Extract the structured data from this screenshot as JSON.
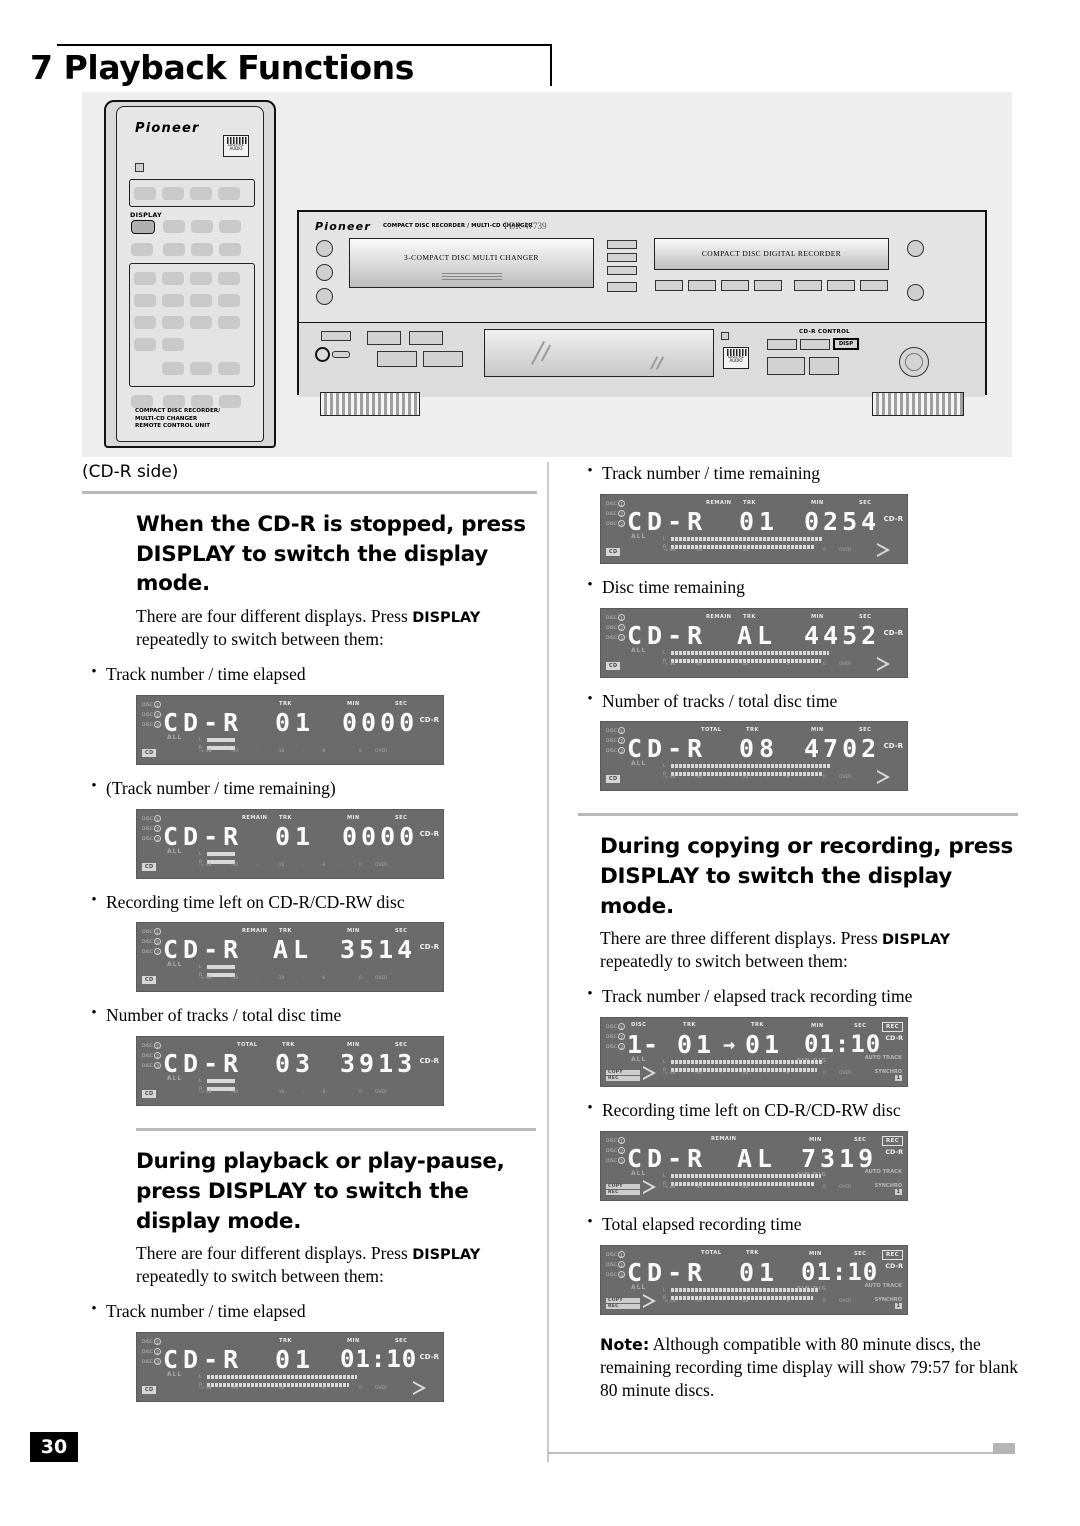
{
  "page": {
    "title": "7 Playback Functions",
    "number": "30"
  },
  "illustration": {
    "remote": {
      "brand": "Pioneer",
      "display_button_label": "DISPLAY",
      "footer_line1": "COMPACT DISC RECORDER/",
      "footer_line2": "MULTI-CD CHANGER",
      "footer_line3": "REMOTE CONTROL UNIT",
      "cd_logo": "COMPACT disc DIGITAL AUDIO"
    },
    "deck": {
      "brand": "Pioneer",
      "model_desc": "COMPACT DISC RECORDER / MULTI-CD CHANGER",
      "model_no": "PDR-W739",
      "changer_tray_label": "3-COMPACT DISC MULTI CHANGER",
      "recorder_tray_label": "COMPACT DISC DIGITAL RECORDER",
      "cdr_control_label": "CD-R CONTROL",
      "disp_button_label": "DISP"
    }
  },
  "left_column": {
    "cdr_side": "(CD-R side)",
    "section1": {
      "heading": "When the CD-R is stopped, press DISPLAY to switch the display mode.",
      "body_pre": "There are four different displays. Press ",
      "body_bold": "DISPLAY",
      "body_post": " repeatedly to switch between them:",
      "items": [
        {
          "label": "Track number / time elapsed"
        },
        {
          "label": "(Track number / time remaining)"
        },
        {
          "label": "Recording time left on CD-R/CD-RW disc"
        },
        {
          "label": "Number of tracks / total disc time"
        }
      ]
    },
    "section2": {
      "heading": "During playback or play-pause, press DISPLAY to switch the display mode.",
      "body_pre": "There are four different displays. Press ",
      "body_bold": "DISPLAY",
      "body_post": " repeatedly to switch between them:",
      "items": [
        {
          "label": "Track number / time elapsed"
        }
      ]
    }
  },
  "right_column": {
    "items_top": [
      {
        "label": "Track number / time remaining"
      },
      {
        "label": "Disc time remaining"
      },
      {
        "label": "Number of tracks / total disc time"
      }
    ],
    "section3": {
      "heading": "During copying or recording, press DISPLAY to switch the display mode.",
      "body_pre": "There are three different displays. Press ",
      "body_bold": "DISPLAY",
      "body_post": " repeatedly to switch between them:",
      "items": [
        {
          "label": "Track number / elapsed track recording time"
        },
        {
          "label": "Recording time left on CD-R/CD-RW disc"
        },
        {
          "label": "Total elapsed recording time"
        }
      ]
    },
    "note": {
      "bold": "Note:",
      "text": " Although compatible with 80 minute discs, the remaining recording time display will show 79:57 for blank 80 minute discs."
    }
  },
  "lcd_common": {
    "disc_labels": [
      "DISC",
      "DISC",
      "DISC"
    ],
    "disc_numbers": [
      "1",
      "2",
      "3"
    ],
    "all_tag": "ALL",
    "cdr_tag": "CD-R",
    "over_tag": "OVER",
    "meter_left": "L",
    "meter_right": "R",
    "scale": [
      "-∞",
      "dB",
      "-40",
      "-",
      "-18",
      "-",
      "-6",
      "-",
      "0"
    ],
    "fin_dig": "FIN DIG",
    "auto_track": "AUTO TRACK",
    "synchro": "SYNCHRO",
    "synchro_badge": "1",
    "rec_badge": "REC",
    "copy_label": "COPY",
    "rec_label": "REC"
  },
  "displays": {
    "l1": {
      "mode": "CD-R",
      "trk": "01",
      "time": "0000",
      "tags": {
        "trk": "TRK",
        "min": "MIN",
        "sec": "SEC"
      },
      "mode_box": "CD",
      "playing": false,
      "remain": false,
      "total": false
    },
    "l2": {
      "mode": "CD-R",
      "trk": "01",
      "time": "0000",
      "tags": {
        "remain": "REMAIN",
        "trk": "TRK",
        "min": "MIN",
        "sec": "SEC"
      },
      "mode_box": "CD",
      "playing": false,
      "remain": true,
      "total": false
    },
    "l3": {
      "mode": "CD-R",
      "trk": "AL",
      "time": "3514",
      "tags": {
        "remain": "REMAIN",
        "trk": "TRK",
        "min": "MIN",
        "sec": "SEC"
      },
      "mode_box": "CD",
      "playing": false,
      "remain": true,
      "total": false
    },
    "l4": {
      "mode": "CD-R",
      "trk": "03",
      "time": "3913",
      "tags": {
        "total": "TOTAL",
        "trk": "TRK",
        "min": "MIN",
        "sec": "SEC"
      },
      "mode_box": "CD",
      "playing": false,
      "remain": false,
      "total": true
    },
    "l5": {
      "mode": "CD-R",
      "trk": "01",
      "time": "01:10",
      "tags": {
        "trk": "TRK",
        "min": "MIN",
        "sec": "SEC"
      },
      "mode_box": "CD",
      "playing": true,
      "remain": false,
      "total": false
    },
    "r1": {
      "mode": "CD-R",
      "trk": "01",
      "time": "0254",
      "tags": {
        "remain": "REMAIN",
        "trk": "TRK",
        "min": "MIN",
        "sec": "SEC"
      },
      "mode_box": "CD",
      "playing": true,
      "remain": true,
      "total": false
    },
    "r2": {
      "mode": "CD-R",
      "trk": "AL",
      "time": "4452",
      "tags": {
        "remain": "REMAIN",
        "trk": "TRK",
        "min": "MIN",
        "sec": "SEC"
      },
      "mode_box": "CD",
      "playing": true,
      "remain": true,
      "total": false
    },
    "r3": {
      "mode": "CD-R",
      "trk": "08",
      "time": "4702",
      "tags": {
        "total": "TOTAL",
        "trk": "TRK",
        "min": "MIN",
        "sec": "SEC"
      },
      "mode_box": "CD",
      "playing": true,
      "remain": false,
      "total": true
    },
    "r4": {
      "mode": "1-",
      "trk": "01",
      "trk2": "01",
      "time": "01:10",
      "tags": {
        "disc": "DISC",
        "trk": "TRK",
        "trk2": "TRK",
        "min": "MIN",
        "sec": "SEC"
      },
      "recording": true,
      "playing": true
    },
    "r5": {
      "mode": "CD-R",
      "trk": "AL",
      "time": "7319",
      "tags": {
        "remain": "REMAIN",
        "min": "MIN",
        "sec": "SEC"
      },
      "recording": true,
      "playing": true
    },
    "r6": {
      "mode": "CD-R",
      "trk": "01",
      "time": "01:10",
      "tags": {
        "total": "TOTAL",
        "trk": "TRK",
        "min": "MIN",
        "sec": "SEC"
      },
      "recording": true,
      "playing": true
    }
  }
}
